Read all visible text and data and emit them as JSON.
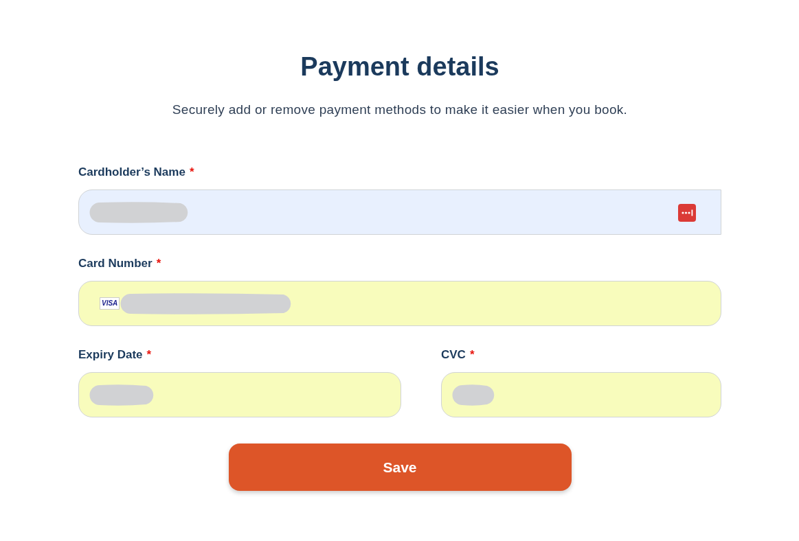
{
  "title": "Payment details",
  "subtitle": "Securely add or remove payment methods to make it easier when you book.",
  "fields": [
    {
      "label": "Cardholder’s Name",
      "required_mark": "*",
      "autofilled": true,
      "redacted": true,
      "password_manager_icon": true,
      "kind": "wide"
    },
    {
      "label": "Card Number",
      "required_mark": "*",
      "autofilled": false,
      "redacted": true,
      "card_brand": "VISA",
      "kind": "wide"
    },
    {
      "label": "Expiry Date",
      "required_mark": "*",
      "autofilled": false,
      "redacted": true,
      "kind": "narrow"
    },
    {
      "label": "CVC",
      "required_mark": "*",
      "autofilled": false,
      "redacted": true,
      "kind": "narrow"
    }
  ],
  "save_button": "Save"
}
